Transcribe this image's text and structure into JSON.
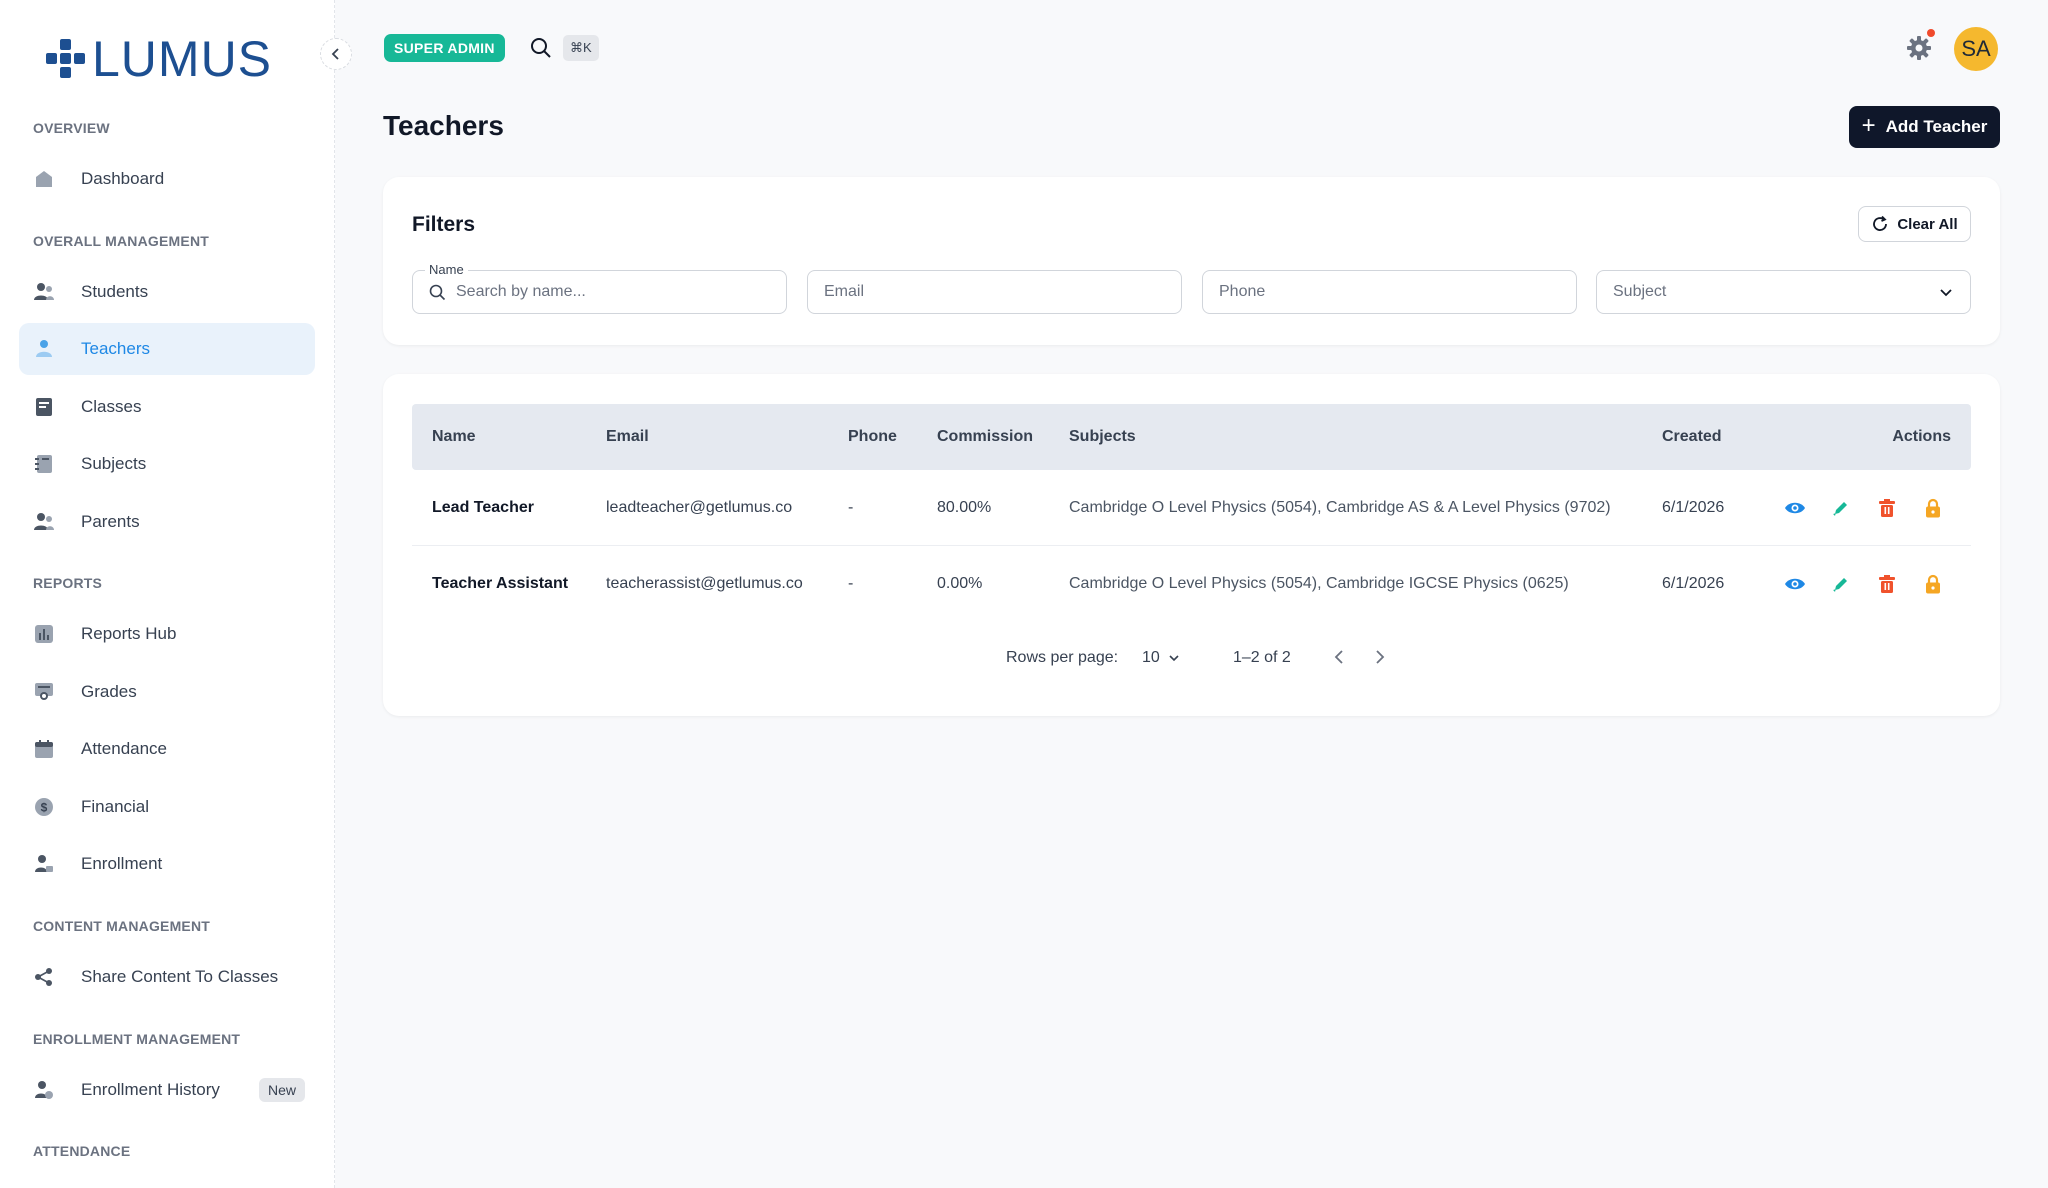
{
  "brand": {
    "logo_text": "LUMUS"
  },
  "sidebar": {
    "sections": [
      {
        "label": "OVERVIEW"
      },
      {
        "label": "OVERALL MANAGEMENT"
      },
      {
        "label": "REPORTS"
      },
      {
        "label": "CONTENT MANAGEMENT"
      },
      {
        "label": "ENROLLMENT MANAGEMENT"
      },
      {
        "label": "ATTENDANCE"
      }
    ],
    "items": [
      {
        "label": "Dashboard",
        "icon": "home-icon"
      },
      {
        "label": "Students",
        "icon": "users-icon"
      },
      {
        "label": "Teachers",
        "icon": "user-icon",
        "active": true
      },
      {
        "label": "Classes",
        "icon": "book-icon"
      },
      {
        "label": "Subjects",
        "icon": "notebook-icon"
      },
      {
        "label": "Parents",
        "icon": "users-icon"
      },
      {
        "label": "Reports Hub",
        "icon": "chart-icon"
      },
      {
        "label": "Grades",
        "icon": "certificate-icon"
      },
      {
        "label": "Attendance",
        "icon": "calendar-icon"
      },
      {
        "label": "Financial",
        "icon": "dollar-icon"
      },
      {
        "label": "Enrollment",
        "icon": "user-lock-icon"
      },
      {
        "label": "Share Content To Classes",
        "icon": "share-icon"
      },
      {
        "label": "Enrollment History",
        "icon": "user-history-icon",
        "badge": "New"
      }
    ]
  },
  "topbar": {
    "role_badge": "SUPER ADMIN",
    "shortcut": "⌘K",
    "avatar_initials": "SA",
    "notification_color": "#f04a2c"
  },
  "page": {
    "title": "Teachers",
    "add_button": "Add Teacher"
  },
  "filters": {
    "title": "Filters",
    "clear_label": "Clear All",
    "name_label": "Name",
    "name_placeholder": "Search by name...",
    "email_placeholder": "Email",
    "phone_placeholder": "Phone",
    "subject_placeholder": "Subject"
  },
  "table": {
    "columns": [
      "Name",
      "Email",
      "Phone",
      "Commission",
      "Subjects",
      "Created",
      "Actions"
    ],
    "rows": [
      {
        "name": "Lead Teacher",
        "email": "leadteacher@getlumus.co",
        "phone": "-",
        "commission": "80.00%",
        "subjects": "Cambridge O Level Physics (5054), Cambridge AS & A Level Physics (9702)",
        "created": "6/1/2026"
      },
      {
        "name": "Teacher Assistant",
        "email": "teacherassist@getlumus.co",
        "phone": "-",
        "commission": "0.00%",
        "subjects": "Cambridge O Level Physics (5054), Cambridge IGCSE Physics (0625)",
        "created": "6/1/2026"
      }
    ],
    "pagination": {
      "rows_per_page_label": "Rows per page:",
      "rows_per_page": "10",
      "range": "1–2 of 2"
    }
  },
  "colors": {
    "accent": "#1e88e5",
    "primary_dark": "#0f172a",
    "badge_green": "#17b897",
    "view": "#1e88e5",
    "edit": "#17b897",
    "delete": "#f0522c",
    "lock": "#f5a623"
  }
}
